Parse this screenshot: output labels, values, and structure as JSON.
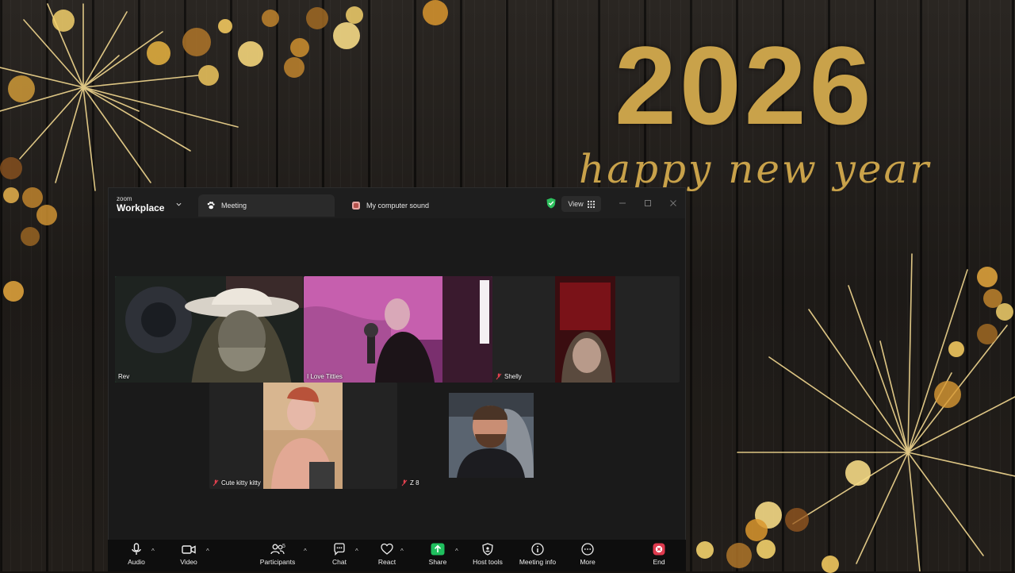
{
  "wallpaper": {
    "year": "2026",
    "greeting": "happy new year"
  },
  "window": {
    "brand_small": "zoom",
    "brand_big": "Workplace",
    "tabs": [
      {
        "label": "Meeting",
        "icon": "paw-icon"
      },
      {
        "label": "My computer sound",
        "icon": "app-icon"
      }
    ],
    "view_label": "View",
    "security_color": "#2dbf5d",
    "active_speaker_color": "#3ed07e"
  },
  "participants": {
    "count": "5",
    "tiles": [
      {
        "name": "Rev",
        "muted": false,
        "active": true
      },
      {
        "name": "I Love Titties",
        "muted": false,
        "active": false
      },
      {
        "name": "Shelly",
        "muted": true,
        "active": false
      },
      {
        "name": "Cute kitty kitty",
        "muted": true,
        "active": false
      },
      {
        "name": "Z 8",
        "muted": true,
        "active": false
      }
    ]
  },
  "toolbar": {
    "audio": "Audio",
    "video": "Video",
    "participants": "Participants",
    "chat": "Chat",
    "react": "React",
    "share": "Share",
    "host_tools": "Host tools",
    "meeting_info": "Meeting info",
    "more": "More",
    "end": "End",
    "share_color": "#1fbf5e",
    "end_color": "#e03a4e"
  }
}
